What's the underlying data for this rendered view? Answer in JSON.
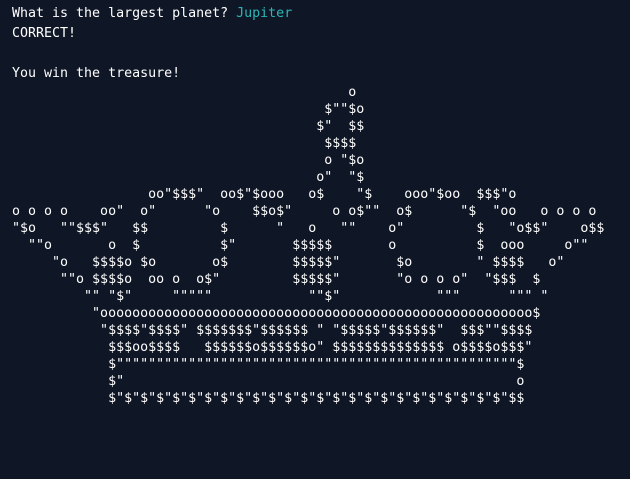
{
  "terminal": {
    "prompt": "What is the largest planet? ",
    "answer": "Jupiter",
    "result": "CORRECT!",
    "blank": "",
    "win_message": "You win the treasure!",
    "ascii_art": "                                          o\n                                       $\"\"$o\n                                      $\"  $$\n                                       $$$$\n                                       o \"$o\n                                      o\"  \"$\n                 oo\"$$$\"  oo$\"$ooo   o$    \"$    ooo\"$oo  $$$\"o\no o o o    oo\"  o\"      \"o    $$o$\"     o o$\"\"  o$      \"$  \"oo   o o o o\n\"$o   \"\"$$$\"   $$         $      \"   o   \"\"    o\"         $   \"o$$\"    o$$\n  \"\"o       o  $          $\"       $$$$$       o          $  ooo     o\"\"\n     \"o   $$$$o $o       o$        $$$$$\"       $o        \" $$$$   o\"\n      \"\"o $$$$o  oo o  o$\"         $$$$$\"       \"o o o o\"  \"$$$  $\n         \"\" \"$\"     \"\"\"\"\"            \"\"$\"            \"\"\"      \"\"\" \"\n          \"oooooooooooooooooooooooooooooooooooooooooooooooooooooo$\n           \"$$$$\"$$$$\" $$$$$$$\"$$$$$$ \" \"$$$$$\"$$$$$$\"  $$$\"\"$$$$\n            $$$oo$$$$   $$$$$$o$$$$$$o\" $$$$$$$$$$$$$$ o$$$$o$$$\"\n            $\"\"\"\"\"\"\"\"\"\"\"\"\"\"\"\"\"\"\"\"\"\"\"\"\"\"\"\"\"\"\"\"\"\"\"\"\"\"\"\"\"\"\"\"\"\"\"\"\"\"$\n            $\"                                                 o\n            $\"$\"$\"$\"$\"$\"$\"$\"$\"$\"$\"$\"$\"$\"$\"$\"$\"$\"$\"$\"$\"$\"$\"$\"$\"$$"
  },
  "colors": {
    "background": "#0f1626",
    "text": "#ffffff",
    "answer": "#2cb5b5"
  }
}
